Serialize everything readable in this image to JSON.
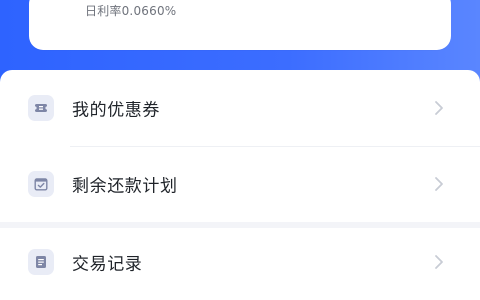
{
  "header": {
    "daily_rate": "日利率0.0660%"
  },
  "menu": [
    {
      "label": "我的优惠券",
      "icon": "coupon-icon"
    },
    {
      "label": "剩余还款计划",
      "icon": "calendar-check-icon"
    },
    {
      "label": "交易记录",
      "icon": "document-icon"
    }
  ],
  "colors": {
    "brand": "#2e63ff",
    "icon_bg": "#e9ecf6",
    "icon_fg": "#7e86a6",
    "chevron": "#c8ccd5"
  }
}
